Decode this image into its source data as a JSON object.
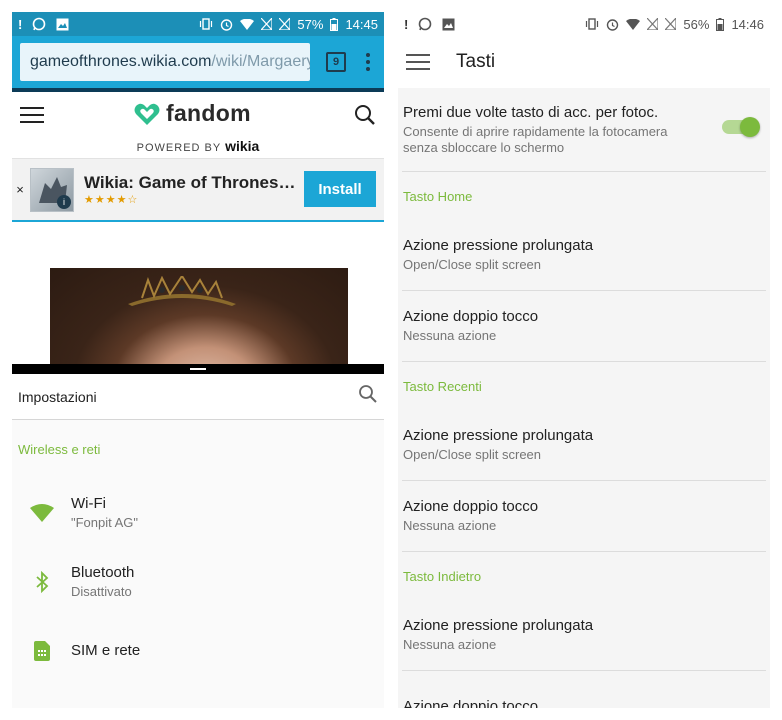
{
  "left": {
    "statusbar": {
      "alert": "!",
      "battery": "57%",
      "time": "14:45"
    },
    "browser": {
      "url_domain": "gameofthrones.wikia.com",
      "url_path": "/wiki/Margaery",
      "tab_count": "9"
    },
    "fandom": {
      "logo_text": "fandom",
      "powered_prefix": "POWERED BY",
      "powered_brand": "wikia"
    },
    "banner": {
      "close": "×",
      "title": "Wikia: Game of Thrones…",
      "stars": "★★★★☆",
      "install_label": "Install"
    },
    "settings": {
      "title": "Impostazioni",
      "section": "Wireless e reti",
      "items": [
        {
          "label": "Wi-Fi",
          "sub": "\"Fonpit AG\"",
          "icon": "wifi-icon"
        },
        {
          "label": "Bluetooth",
          "sub": "Disattivato",
          "icon": "bluetooth-icon"
        },
        {
          "label": "SIM e rete",
          "sub": "",
          "icon": "sim-icon"
        }
      ]
    }
  },
  "right": {
    "statusbar": {
      "alert": "!",
      "battery": "56%",
      "time": "14:46"
    },
    "title": "Tasti",
    "top_item": {
      "label": "Premi due volte tasto di acc. per fotoc.",
      "sub": "Consente di aprire rapidamente la fotocamera senza sbloccare lo schermo",
      "toggle_on": true
    },
    "sections": [
      {
        "header": "Tasto Home",
        "items": [
          {
            "label": "Azione pressione prolungata",
            "sub": "Open/Close split screen"
          },
          {
            "label": "Azione doppio tocco",
            "sub": "Nessuna azione"
          }
        ]
      },
      {
        "header": "Tasto Recenti",
        "items": [
          {
            "label": "Azione pressione prolungata",
            "sub": "Open/Close split screen"
          },
          {
            "label": "Azione doppio tocco",
            "sub": "Nessuna azione"
          }
        ]
      },
      {
        "header": "Tasto Indietro",
        "items": [
          {
            "label": "Azione pressione prolungata",
            "sub": "Nessuna azione"
          },
          {
            "label": "Azione doppio tocco",
            "sub": ""
          }
        ]
      }
    ]
  },
  "colors": {
    "accent_green": "#7cba3d",
    "browser_blue": "#1ca6d6",
    "statusbar_blue": "#1c8fb7"
  }
}
